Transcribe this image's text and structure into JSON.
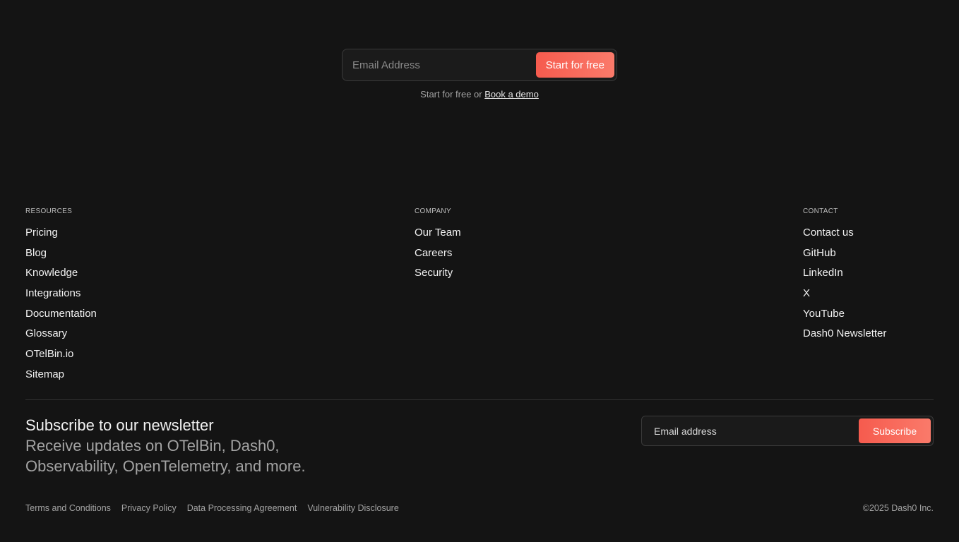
{
  "hero": {
    "email_placeholder": "Email Address",
    "cta_label": "Start for free",
    "note_prefix": "Start for free or",
    "demo_link": "Book a demo"
  },
  "footer": {
    "resources": {
      "heading": "RESOURCES",
      "links": [
        "Pricing",
        "Blog",
        "Knowledge",
        "Integrations",
        "Documentation",
        "Glossary",
        "OTelBin.io",
        "Sitemap"
      ]
    },
    "company": {
      "heading": "COMPANY",
      "links": [
        "Our Team",
        "Careers",
        "Security"
      ]
    },
    "contact": {
      "heading": "CONTACT",
      "links": [
        "Contact us",
        "GitHub",
        "LinkedIn",
        "X",
        "YouTube",
        "Dash0 Newsletter"
      ]
    }
  },
  "newsletter": {
    "title": "Subscribe to our newsletter",
    "subtitle": "Receive updates on OTelBin, Dash0, Observability, OpenTelemetry, and more.",
    "email_placeholder": "Email address",
    "subscribe_label": "Subscribe"
  },
  "legal": {
    "links": [
      "Terms and Conditions",
      "Privacy Policy",
      "Data Processing Agreement",
      "Vulnerability Disclosure"
    ],
    "copyright": "©2025 Dash0 Inc."
  },
  "colors": {
    "background": "#141414",
    "accent_start": "#f65b4e",
    "accent_end": "#fa7a6a",
    "muted_text": "#a3a3a3"
  }
}
